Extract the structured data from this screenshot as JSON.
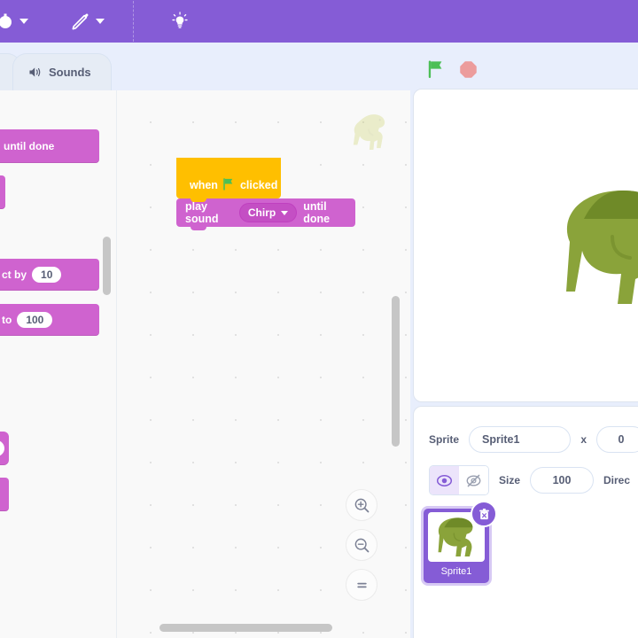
{
  "menubar": {
    "background": "#855CD6",
    "items": [
      {
        "name": "language-menu",
        "icon": "globe-icon",
        "label": ""
      },
      {
        "name": "edit-menu",
        "icon": "pencil-icon",
        "label": ""
      },
      {
        "name": "tutorials-button",
        "icon": "lightbulb-icon",
        "label": ""
      }
    ]
  },
  "tabs": [
    {
      "label": "",
      "icon": "paintbrush-icon",
      "name": "tab-costumes",
      "active": false
    },
    {
      "label": "Sounds",
      "icon": "speaker-icon",
      "name": "tab-sounds",
      "active": true
    }
  ],
  "stage_controls": {
    "green_flag": "green-flag-icon",
    "stop": "stop-icon",
    "green_flag_color": "#4CBF56",
    "stop_color": "#EC9C9C"
  },
  "palette": {
    "blocks": [
      {
        "text": "until done",
        "value": ""
      },
      {
        "text": "",
        "value": ""
      },
      {
        "text": "ct by",
        "value": "10"
      },
      {
        "text": "to",
        "value": "100"
      },
      {
        "text": "",
        "value": ""
      },
      {
        "text": "",
        "value": ""
      }
    ],
    "block_color": "#CF63CF"
  },
  "script": {
    "hat": {
      "prefix": "when",
      "icon": "green-flag-icon",
      "suffix": "clicked",
      "color": "#FFBF00"
    },
    "command": {
      "prefix": "play sound",
      "dropdown_value": "Chirp",
      "suffix": "until done",
      "color": "#CF63CF"
    }
  },
  "zoom_controls": [
    {
      "name": "zoom-in-button",
      "icon": "zoom-in-icon"
    },
    {
      "name": "zoom-out-button",
      "icon": "zoom-out-icon"
    },
    {
      "name": "zoom-reset-button",
      "icon": "equals-icon"
    }
  ],
  "stage": {
    "sprite_image": "dinosaur-sprite",
    "background": "#FFFFFF"
  },
  "sprite_info": {
    "sprite_label": "Sprite",
    "sprite_name": "Sprite1",
    "x_label": "x",
    "x_value": "0",
    "size_label": "Size",
    "size_value": "100",
    "direction_label": "Direc",
    "show_icon": "eye-icon",
    "hide_icon": "eye-slash-icon",
    "visible": true
  },
  "sprite_list": [
    {
      "name": "Sprite1",
      "thumbnail": "dinosaur-sprite",
      "selected": true,
      "delete_icon": "trash-icon"
    }
  ]
}
